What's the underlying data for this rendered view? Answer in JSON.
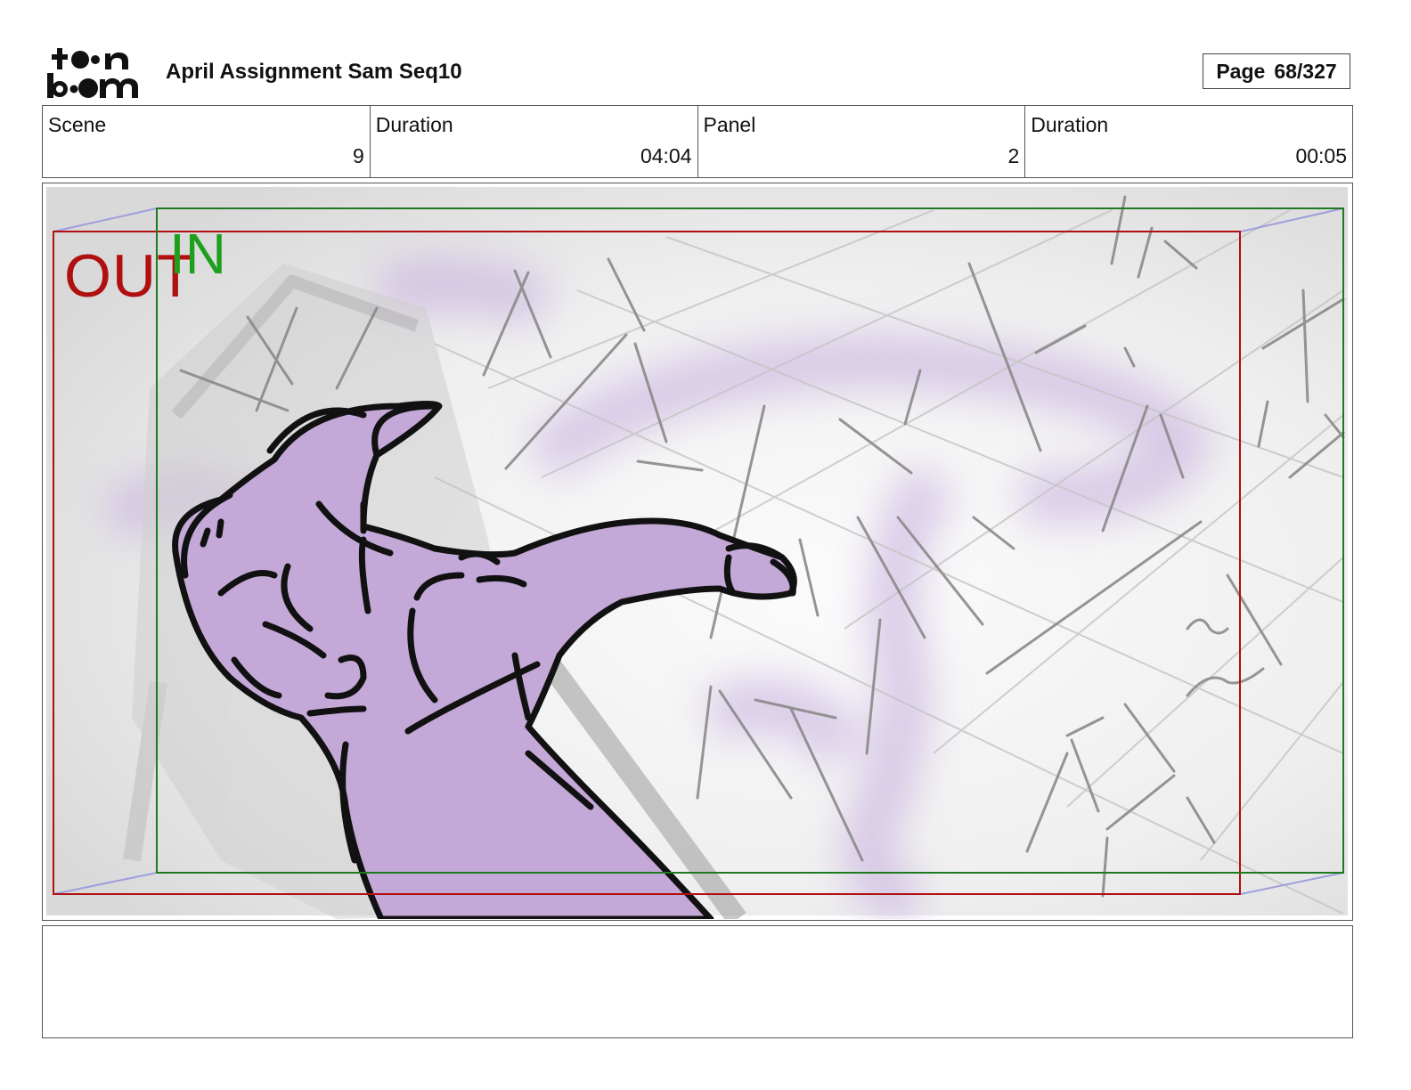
{
  "header": {
    "logo_name": "toon boom",
    "title": "April Assignment Sam Seq10",
    "page_label": "Page",
    "page_value": "68/327"
  },
  "info": [
    {
      "label": "Scene",
      "value": "9"
    },
    {
      "label": "Duration",
      "value": "04:04"
    },
    {
      "label": "Panel",
      "value": "2"
    },
    {
      "label": "Duration",
      "value": "00:05"
    }
  ],
  "panel": {
    "out_label": "OUT",
    "in_label": "IN",
    "colors": {
      "out_frame": "#b01010",
      "in_frame": "#1e7a1e",
      "in_text": "#1ea01e",
      "character_fill": "#c3a8d8",
      "glow": "#c9b2e0"
    }
  },
  "notes": {}
}
